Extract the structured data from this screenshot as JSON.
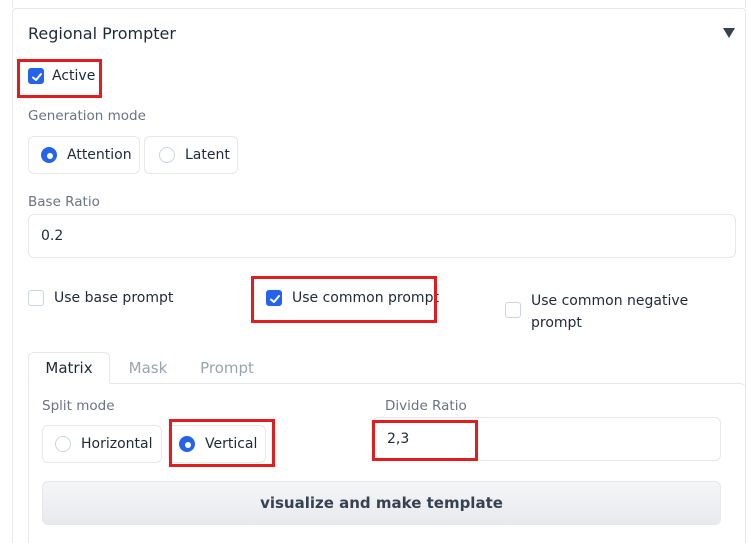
{
  "panel": {
    "title": "Regional Prompter",
    "collapse_icon": "triangle-down-icon"
  },
  "active": {
    "label": "Active",
    "checked": true
  },
  "generation_mode": {
    "label": "Generation mode",
    "options": [
      {
        "label": "Attention",
        "selected": true
      },
      {
        "label": "Latent",
        "selected": false
      }
    ]
  },
  "base_ratio": {
    "label": "Base Ratio",
    "value": "0.2"
  },
  "checkboxes": {
    "use_base_prompt": {
      "label": "Use base prompt",
      "checked": false
    },
    "use_common_prompt": {
      "label": "Use common prompt",
      "checked": true
    },
    "use_common_negative_prompt": {
      "label_line1": "Use common negative",
      "label_line2": "prompt",
      "checked": false
    }
  },
  "tabs": [
    {
      "label": "Matrix",
      "active": true
    },
    {
      "label": "Mask",
      "active": false
    },
    {
      "label": "Prompt",
      "active": false
    }
  ],
  "matrix": {
    "split_mode": {
      "label": "Split mode",
      "options": [
        {
          "label": "Horizontal",
          "selected": false
        },
        {
          "label": "Vertical",
          "selected": true
        }
      ]
    },
    "divide_ratio": {
      "label": "Divide Ratio",
      "value": "2,3"
    },
    "button_label": "visualize and make template"
  },
  "colors": {
    "accent": "#2563eb",
    "highlight": "#e11d1d",
    "border": "#e5e7eb"
  }
}
